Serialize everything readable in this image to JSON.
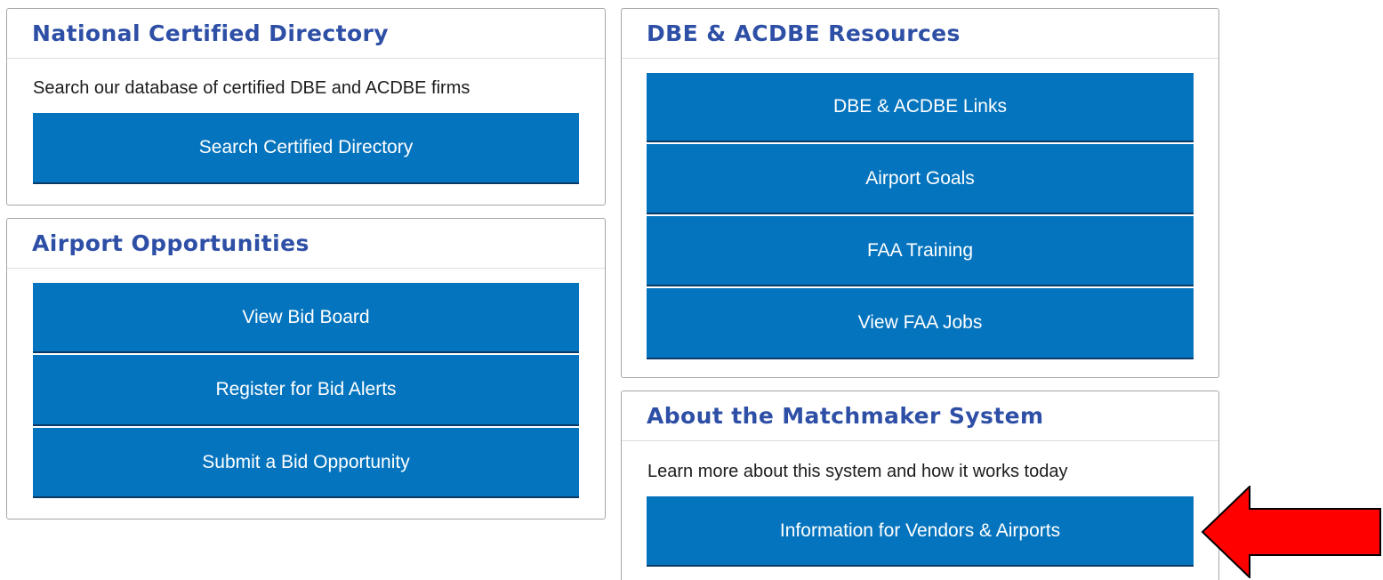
{
  "directory": {
    "title": "National Certified Directory",
    "description": "Search our database of certified DBE and ACDBE firms",
    "search_button": "Search Certified Directory"
  },
  "opportunities": {
    "title": "Airport Opportunities",
    "buttons": [
      "View Bid Board",
      "Register for Bid Alerts",
      "Submit a Bid Opportunity"
    ]
  },
  "resources": {
    "title": "DBE & ACDBE Resources",
    "buttons": [
      "DBE & ACDBE Links",
      "Airport Goals",
      "FAA Training",
      "View FAA Jobs"
    ]
  },
  "about": {
    "title": "About the Matchmaker System",
    "description": "Learn more about this system and how it works today",
    "info_button": "Information for Vendors & Airports"
  },
  "colors": {
    "title_text": "#2e4fa6",
    "button_bg": "#0574be",
    "button_text": "#ffffff",
    "annotation_arrow": "#ff0000"
  },
  "icons": {
    "annotation": "red-left-arrow"
  }
}
